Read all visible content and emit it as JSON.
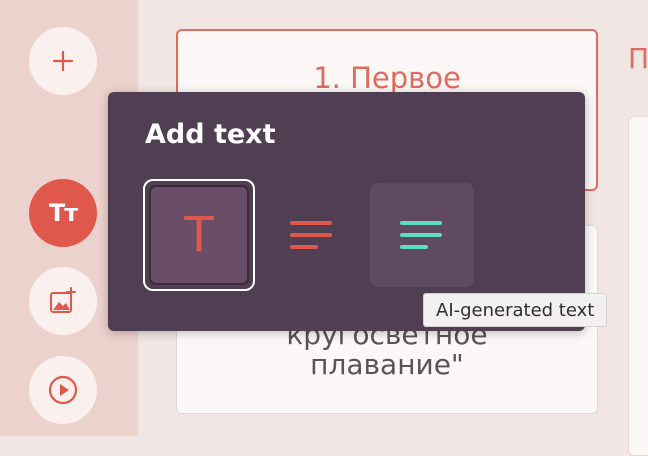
{
  "colors": {
    "accent": "#e0584c",
    "ai_accent": "#5fdcc4",
    "popup_bg": "#503e52"
  },
  "sidebar": {
    "add_icon": "plus-icon",
    "text_button_label": "Tт",
    "image_icon": "add-image-icon",
    "video_icon": "play-icon"
  },
  "slides": {
    "slide1_title": "1. Первое",
    "slide2_line1": "кругосветное",
    "slide2_line2": "плавание\"",
    "partial_title_glyph": "П"
  },
  "popup": {
    "title": "Add text",
    "options": [
      {
        "icon": "heading-t-icon",
        "glyph": "T",
        "state": "selected"
      },
      {
        "icon": "paragraph-lines-icon"
      },
      {
        "icon": "ai-text-lines-icon",
        "state": "hovered"
      }
    ]
  },
  "tooltip": {
    "text": "AI-generated text"
  }
}
